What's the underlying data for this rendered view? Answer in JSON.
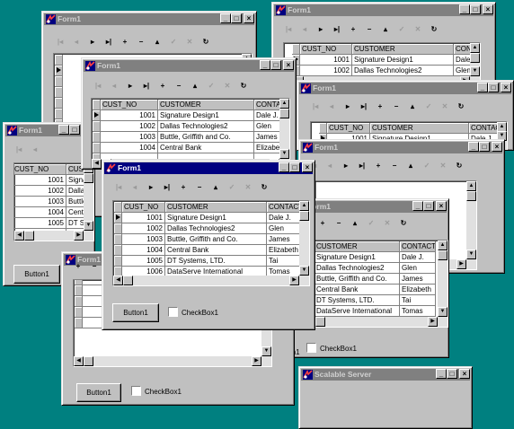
{
  "desktop": {
    "background": "#008080"
  },
  "titles": {
    "form": "Form1",
    "server": "Scalable Server"
  },
  "title_buttons": {
    "minimize": "_",
    "maximize": "□",
    "close": "×"
  },
  "navigator": {
    "first": "|◂",
    "prior": "◂",
    "next": "▸",
    "last": "▸|",
    "insert": "+",
    "delete": "−",
    "edit": "▴",
    "post": "✓",
    "cancel": "✕",
    "refresh": "↻"
  },
  "grid": {
    "columns": [
      "CUST_NO",
      "CUSTOMER",
      "CONTACT"
    ],
    "rows": [
      [
        "1001",
        "Signature Design1",
        "Dale J."
      ],
      [
        "1002",
        "Dallas Technologies2",
        "Glen"
      ],
      [
        "1003",
        "Buttle, Griffith and Co.",
        "James"
      ],
      [
        "1004",
        "Central Bank",
        "Elizabeth"
      ],
      [
        "1005",
        "DT Systems, LTD.",
        "Tai"
      ],
      [
        "1006",
        "DataServe International",
        "Tomas"
      ]
    ]
  },
  "controls": {
    "button1": "Button1",
    "checkbox1": "CheckBox1"
  },
  "icons": [
    "app-icon",
    "minimize-icon",
    "maximize-icon",
    "close-icon",
    "scroll-up-icon",
    "scroll-down-icon",
    "scroll-left-icon",
    "scroll-right-icon",
    "row-indicator-icon"
  ]
}
